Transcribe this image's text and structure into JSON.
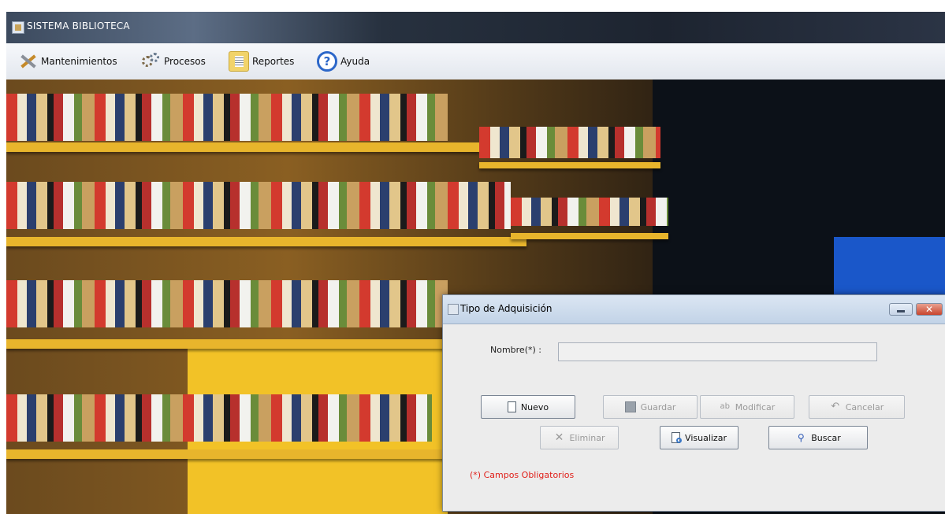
{
  "window": {
    "title": "SISTEMA BIBLIOTECA"
  },
  "menu": {
    "items": [
      {
        "label": "Mantenimientos",
        "icon": "tools-icon"
      },
      {
        "label": "Procesos",
        "icon": "gears-icon"
      },
      {
        "label": "Reportes",
        "icon": "report-icon"
      },
      {
        "label": "Ayuda",
        "icon": "help-icon"
      }
    ]
  },
  "dialog": {
    "title": "Tipo de Adquisición",
    "field_label": "Nombre(*) :",
    "field_value": "",
    "buttons": {
      "nuevo": "Nuevo",
      "guardar": "Guardar",
      "modificar": "Modificar",
      "cancelar": "Cancelar",
      "eliminar": "Eliminar",
      "visualizar": "Visualizar",
      "buscar": "Buscar"
    },
    "required_note": "(*) Campos Obligatorios"
  },
  "colors": {
    "accent": "#2c67c9",
    "required": "#e0201a",
    "close": "#c8452d"
  }
}
